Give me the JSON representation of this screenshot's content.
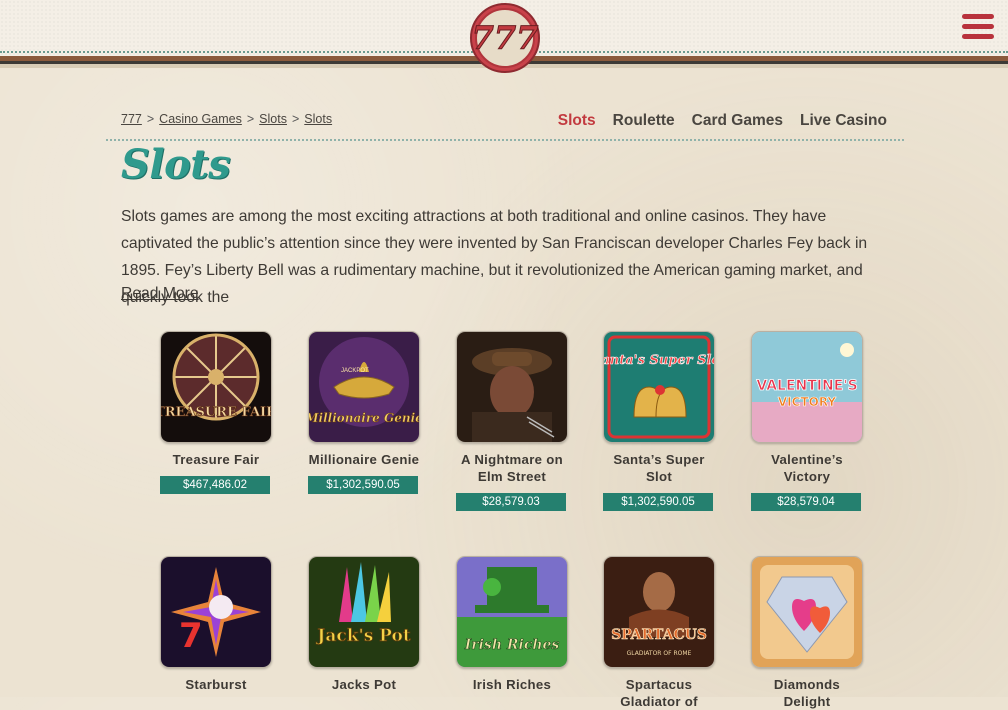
{
  "header": {
    "logo_text": "777",
    "menu_icon": "hamburger-menu-icon"
  },
  "breadcrumb": [
    {
      "label": "777"
    },
    {
      "label": "Casino Games"
    },
    {
      "label": "Slots"
    },
    {
      "label": "Slots"
    }
  ],
  "breadcrumb_separator": ">",
  "nav_tabs": [
    {
      "label": "Slots",
      "active": true
    },
    {
      "label": "Roulette",
      "active": false
    },
    {
      "label": "Card Games",
      "active": false
    },
    {
      "label": "Live Casino",
      "active": false
    }
  ],
  "page": {
    "title": "Slots",
    "intro": "Slots games are among the most exciting attractions at both traditional and online casinos. They have captivated the public’s attention since they were invented by San Franciscan developer Charles Fey back in 1895. Fey’s Liberty Bell was a rudimentary machine, but it revolutionized the American gaming market, and quickly took the",
    "read_more": "Read More"
  },
  "games_row1": [
    {
      "name": "Treasure Fair",
      "jackpot": "$467,486.02"
    },
    {
      "name": "Millionaire Genie",
      "jackpot": "$1,302,590.05"
    },
    {
      "name": "A Nightmare on Elm Street",
      "jackpot": "$28,579.03"
    },
    {
      "name": "Santa’s Super Slot",
      "jackpot": "$1,302,590.05"
    },
    {
      "name": "Valentine’s Victory",
      "jackpot": "$28,579.04"
    }
  ],
  "games_row2": [
    {
      "name": "Starburst"
    },
    {
      "name": "Jacks Pot"
    },
    {
      "name": "Irish Riches"
    },
    {
      "name": "Spartacus Gladiator of"
    },
    {
      "name": "Diamonds Delight"
    }
  ],
  "thumb_labels": {
    "treasure": "TREASURE FAIR",
    "genie": "Millionaire Genie",
    "jackpot_small": "JACKPOT",
    "santa": "Santa's Super Slot",
    "valentine1": "VALENTINE'S",
    "valentine2": "VICTORY",
    "jackspot": "Jack's Pot",
    "irish": "Irish Riches",
    "spartacus": "SPARTACUS",
    "spartacus_sub": "GLADIATOR OF ROME"
  },
  "colors": {
    "accent": "#c23a3f",
    "title": "#2f9a8d",
    "jackpot_bg": "#25806f"
  }
}
